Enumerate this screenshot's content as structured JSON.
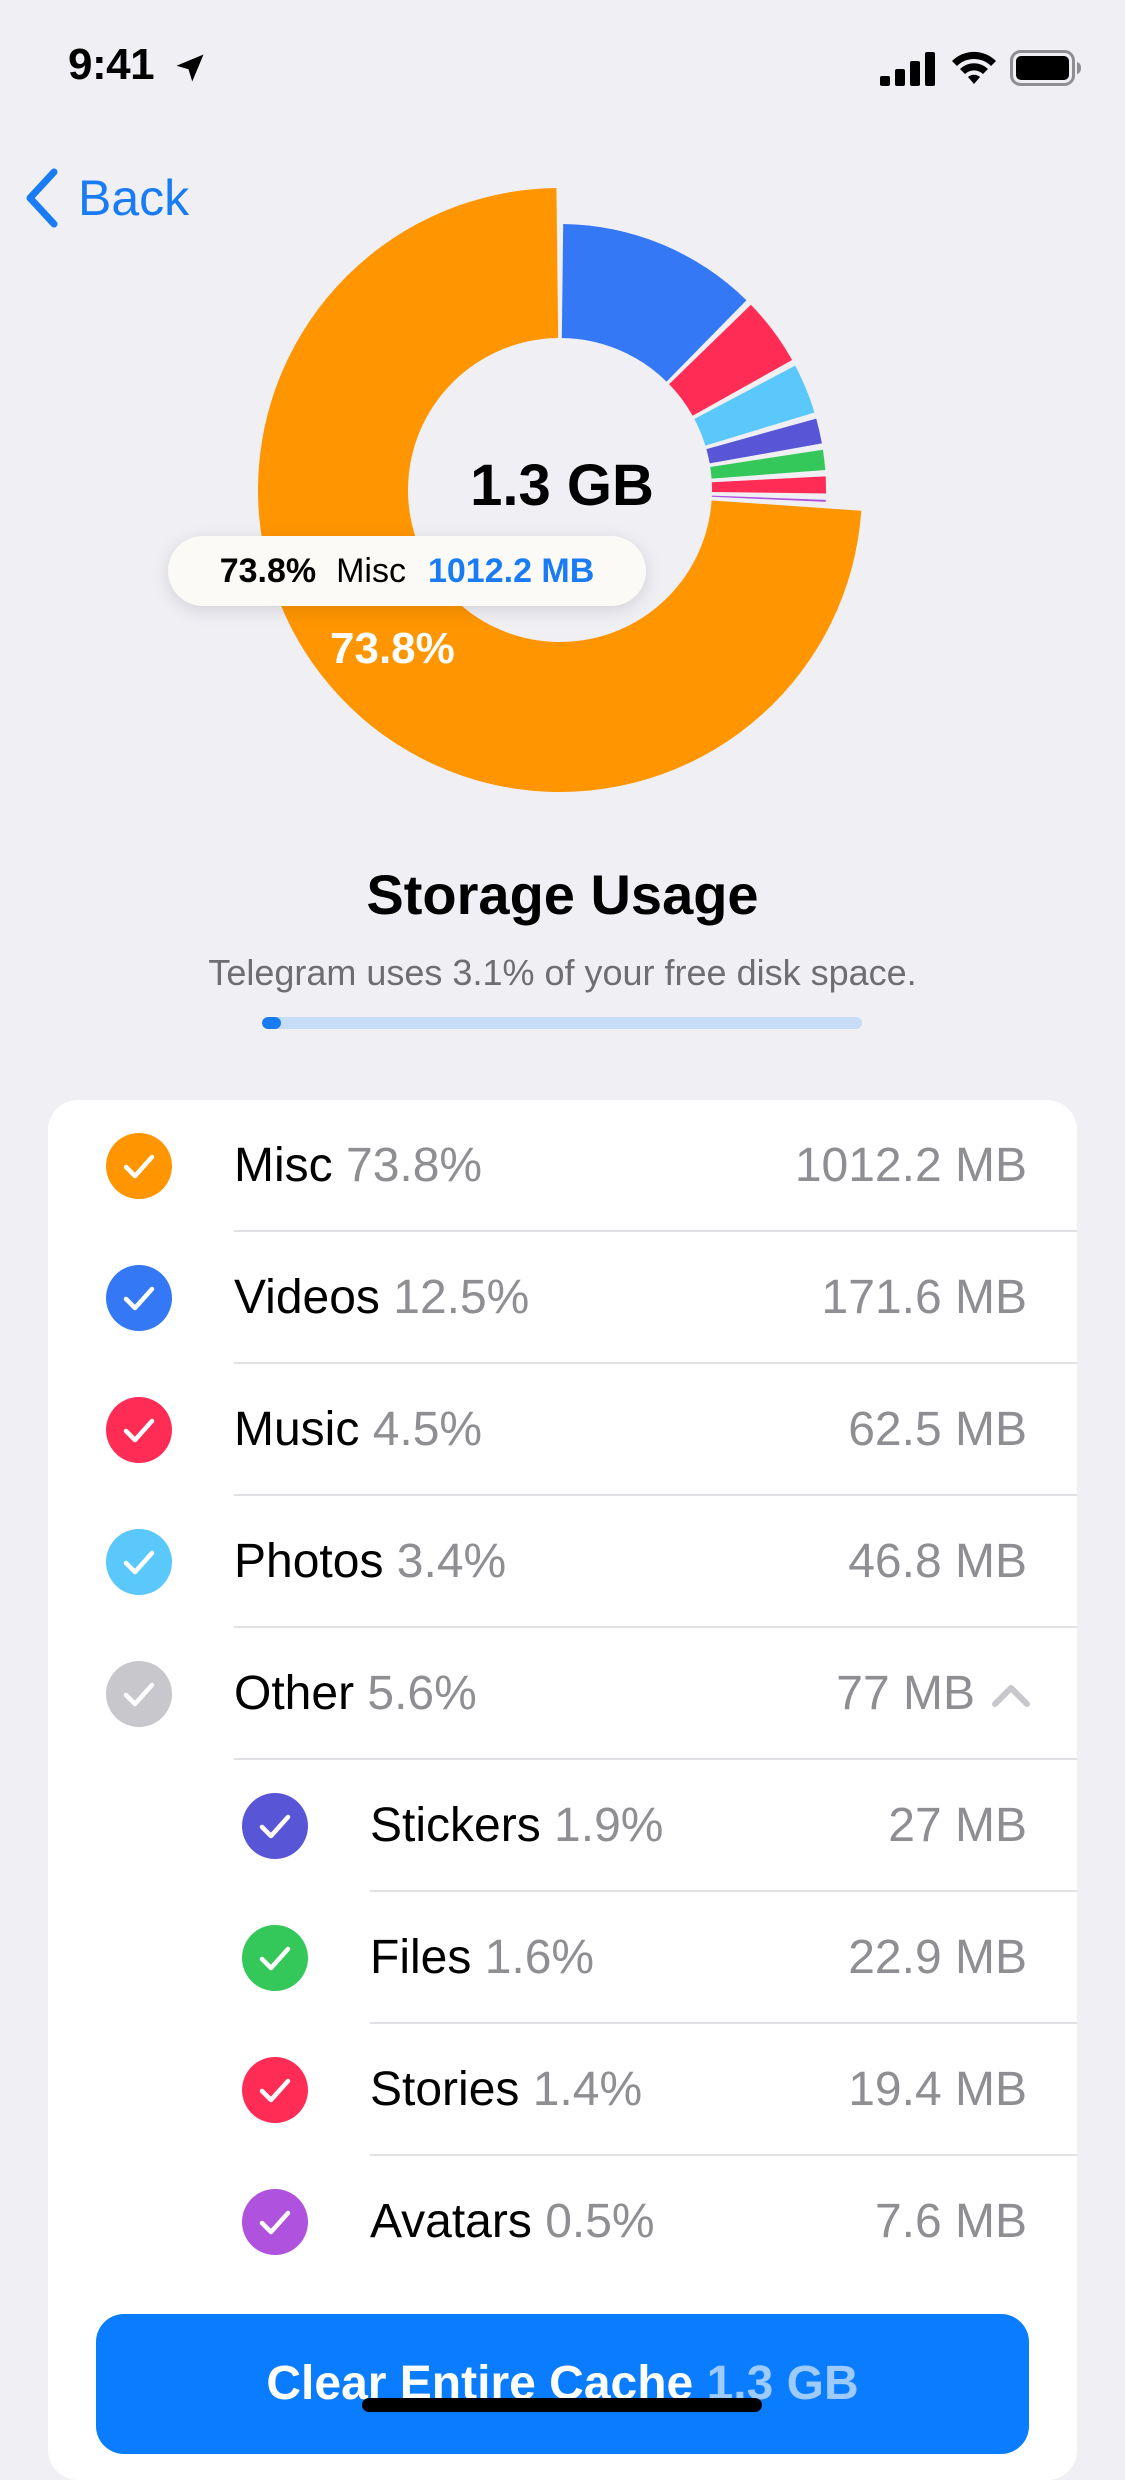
{
  "status_bar": {
    "time": "9:41"
  },
  "nav": {
    "back_label": "Back"
  },
  "chart_data": {
    "type": "pie",
    "unit": "MB",
    "total_label": "1.3 GB",
    "categories": [
      "Misc",
      "Videos",
      "Music",
      "Photos",
      "Stickers",
      "Files",
      "Stories",
      "Avatars"
    ],
    "values": [
      73.8,
      12.5,
      4.5,
      3.4,
      1.9,
      1.6,
      1.4,
      0.5
    ],
    "colors": [
      "#ff9500",
      "#3478f6",
      "#ff2d55",
      "#5ac8fa",
      "#5856d6",
      "#34c759",
      "#ff2d55",
      "#af52de"
    ],
    "highlighted": "Misc",
    "slice_label": "73.8%"
  },
  "tooltip": {
    "percent": "73.8%",
    "label": "Misc",
    "size": "1012.2 MB"
  },
  "storage": {
    "title": "Storage Usage",
    "subtitle": "Telegram uses 3.1% of your free disk space.",
    "disk_usage_fraction": 0.031
  },
  "items": [
    {
      "name": "Misc",
      "percent": "73.8%",
      "size": "1012.2 MB",
      "color": "#ff9500",
      "checked": true
    },
    {
      "name": "Videos",
      "percent": "12.5%",
      "size": "171.6 MB",
      "color": "#3478f6",
      "checked": true
    },
    {
      "name": "Music",
      "percent": "4.5%",
      "size": "62.5 MB",
      "color": "#ff2d55",
      "checked": true
    },
    {
      "name": "Photos",
      "percent": "3.4%",
      "size": "46.8 MB",
      "color": "#5ac8fa",
      "checked": true
    },
    {
      "name": "Other",
      "percent": "5.6%",
      "size": "77 MB",
      "color": "#c7c7cc",
      "checked": true,
      "expanded": true
    }
  ],
  "sub_items": [
    {
      "name": "Stickers",
      "percent": "1.9%",
      "size": "27 MB",
      "color": "#5856d6",
      "checked": true
    },
    {
      "name": "Files",
      "percent": "1.6%",
      "size": "22.9 MB",
      "color": "#34c759",
      "checked": true
    },
    {
      "name": "Stories",
      "percent": "1.4%",
      "size": "19.4 MB",
      "color": "#ff2d55",
      "checked": true
    },
    {
      "name": "Avatars",
      "percent": "0.5%",
      "size": "7.6 MB",
      "color": "#af52de",
      "checked": true
    }
  ],
  "clear_button": {
    "label": "Clear Entire Cache",
    "size": "1.3 GB"
  }
}
